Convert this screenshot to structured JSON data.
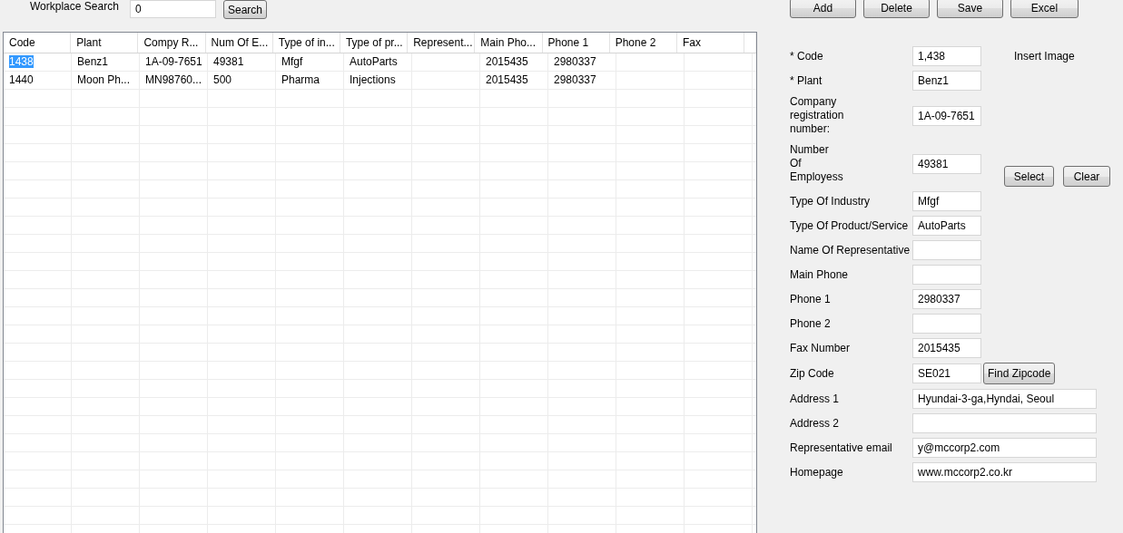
{
  "search": {
    "label": "Workplace Search",
    "value": "0",
    "button": "Search"
  },
  "toolbar": [
    "Add",
    "Delete",
    "Save",
    "Excel"
  ],
  "table": {
    "columns": [
      "Code",
      "Plant",
      "Compy R...",
      "Num Of E...",
      "Type of in...",
      "Type of pr...",
      "Represent...",
      "Main Pho...",
      "Phone 1",
      "Phone 2",
      "Fax"
    ],
    "rows": [
      {
        "selected": true,
        "cells": [
          "1438",
          "Benz1",
          "1A-09-7651",
          "49381",
          "Mfgf",
          "AutoParts",
          "",
          "2015435",
          "2980337",
          "",
          ""
        ]
      },
      {
        "selected": false,
        "cells": [
          "1440",
          "Moon Ph...",
          "MN98760...",
          "500",
          "Pharma",
          "Injections",
          "",
          "2015435",
          "2980337",
          "",
          ""
        ]
      }
    ]
  },
  "form": {
    "fields": [
      {
        "label": "* Code",
        "value": "1,438",
        "wide": false
      },
      {
        "label": "* Plant",
        "value": "Benz1",
        "wide": false
      },
      {
        "label": "Company\nregistration\nnumber:",
        "value": "1A-09-7651",
        "wide": false
      },
      {
        "label": "Number\nOf\nEmployess",
        "value": "49381",
        "wide": false
      },
      {
        "label": "Type Of Industry",
        "value": "Mfgf",
        "wide": false
      },
      {
        "label": "Type Of Product/Service",
        "value": "AutoParts",
        "wide": false
      },
      {
        "label": "Name Of Representative",
        "wide": false
      },
      {
        "label": "Main Phone",
        "wide": false
      },
      {
        "label": "Phone 1",
        "value": "2980337",
        "wide": false
      },
      {
        "label": "Phone 2",
        "wide": false
      },
      {
        "label": "Fax Number",
        "value": "2015435",
        "wide": false
      },
      {
        "label": "Zip Code",
        "value": "SE021",
        "wide": false,
        "button": "Find Zipcode"
      },
      {
        "label": "Address 1",
        "value": "Hyundai-3-ga,Hyndai, Seoul",
        "wide": true
      },
      {
        "label": "Address 2",
        "wide": true
      },
      {
        "label": "Representative email",
        "value": "y@mccorp2.com",
        "wide": true
      },
      {
        "label": "Homepage",
        "value": "www.mccorp2.co.kr",
        "wide": true
      }
    ],
    "image": {
      "label": "Insert Image",
      "buttons": [
        "Select",
        "Clear"
      ]
    }
  }
}
